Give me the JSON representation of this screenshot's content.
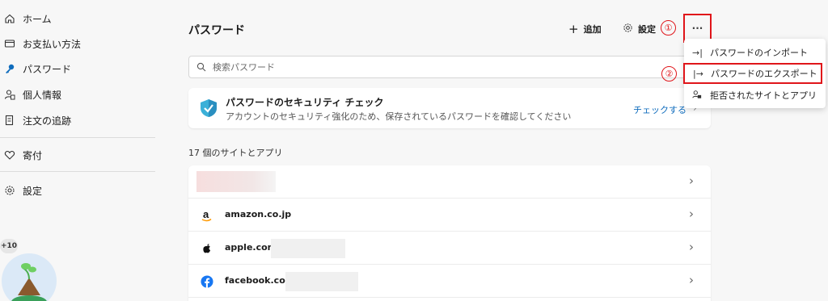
{
  "sidebar": {
    "items": [
      {
        "label": "ホーム",
        "icon": "home-icon"
      },
      {
        "label": "お支払い方法",
        "icon": "card-icon"
      },
      {
        "label": "パスワード",
        "icon": "key-icon"
      },
      {
        "label": "個人情報",
        "icon": "person-icon"
      },
      {
        "label": "注文の追跡",
        "icon": "receipt-icon"
      },
      {
        "label": "寄付",
        "icon": "heart-icon"
      },
      {
        "label": "設定",
        "icon": "gear-icon"
      }
    ],
    "badge": "+10"
  },
  "header": {
    "title": "パスワード",
    "add_label": "追加",
    "settings_label": "設定",
    "more_label": "···",
    "annotation_1": "①",
    "annotation_2": "②"
  },
  "search": {
    "placeholder": "検索パスワード"
  },
  "security_card": {
    "title": "パスワードのセキュリティ チェック",
    "subtitle": "アカウントのセキュリティ強化のため、保存されているパスワードを確認してください",
    "action": "チェックする"
  },
  "list": {
    "count_label": "17 個のサイトとアプリ",
    "rows": [
      {
        "site": "",
        "icon": "blurred"
      },
      {
        "site": "amazon.co.jp",
        "icon": "amazon-icon"
      },
      {
        "site": "apple.com",
        "icon": "apple-icon"
      },
      {
        "site": "facebook.com",
        "icon": "facebook-icon"
      }
    ]
  },
  "menu": {
    "import": "パスワードのインポート",
    "export": "パスワードのエクスポート",
    "blocked": "拒否されたサイトとアプリ"
  },
  "colors": {
    "accent": "#0f6cbd",
    "annotation": "#e0151a",
    "key_blue": "#0f6cbd"
  }
}
